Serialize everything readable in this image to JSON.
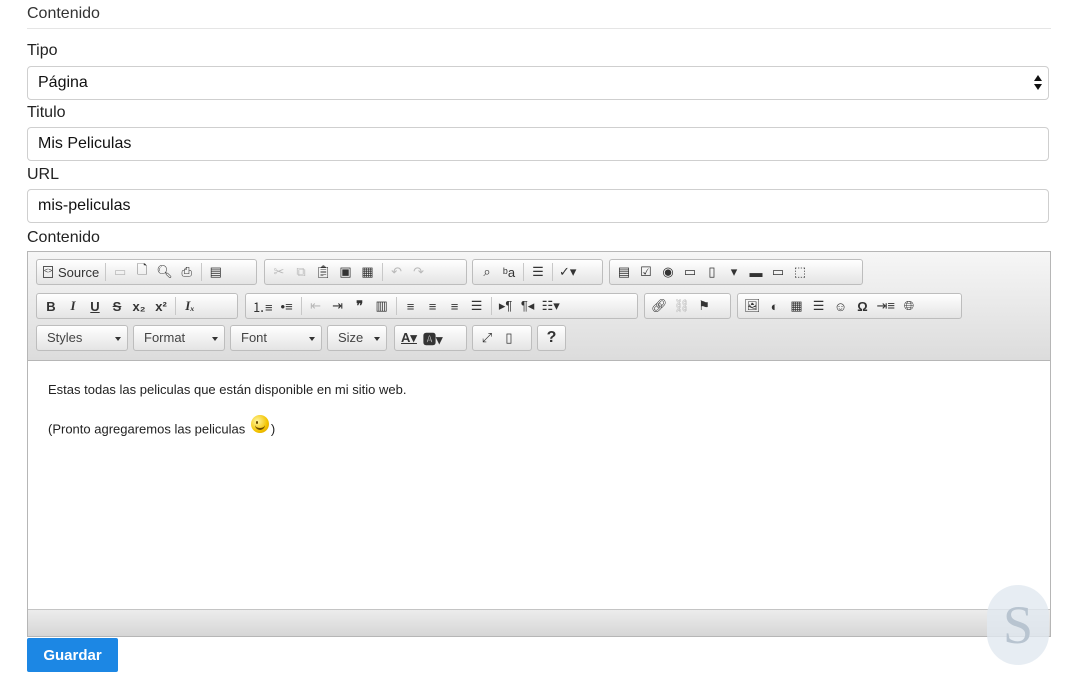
{
  "section": {
    "title": "Contenido"
  },
  "tipo": {
    "label": "Tipo",
    "value": "Página"
  },
  "titulo": {
    "label": "Titulo",
    "value": "Mis Peliculas"
  },
  "url": {
    "label": "URL",
    "value": "mis-peliculas"
  },
  "contenido": {
    "label": "Contenido"
  },
  "editor": {
    "source_label": "Source",
    "combos": {
      "styles": "Styles",
      "format": "Format",
      "font": "Font",
      "size": "Size"
    },
    "help_label": "?",
    "body": {
      "line1": "Estas todas las peliculas que están disponible en mi sitio web.",
      "line2_before": "(Pronto agregaremos las peliculas ",
      "line2_after": ")"
    }
  },
  "save_button": "Guardar",
  "watermark": "S",
  "colors": {
    "accent": "#1c87e4"
  }
}
